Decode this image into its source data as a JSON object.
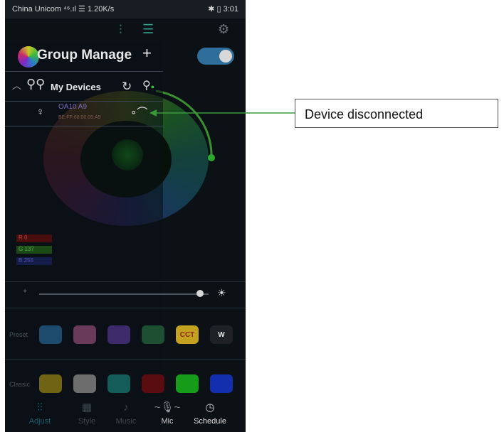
{
  "status_bar": {
    "left": "China Unicom ⁴⁶.ıl ☰ 1.20K/s",
    "right": "✱ ▯ 3:01"
  },
  "top_bar": {
    "icons": [
      "sliders-icon",
      "list-icon",
      "gear-icon"
    ]
  },
  "drawer": {
    "title": "Group Manage",
    "add_label": "+",
    "toggle_on": true,
    "group": {
      "label": "My Devices"
    },
    "device": {
      "name": "OA10 A9",
      "mac": "BE:FF:68:00:05:A9",
      "status_icon": "link-broken-icon"
    }
  },
  "rgb": {
    "r_label": "R",
    "r_value": "0",
    "g_label": "G",
    "g_value": "137",
    "b_label": "B",
    "b_value": "255"
  },
  "slider": {
    "level": 0.95
  },
  "preset": {
    "label": "Preset",
    "swatches": [
      {
        "color": "#1c4b6e",
        "text": ""
      },
      {
        "color": "#6a3a5a",
        "text": ""
      },
      {
        "color": "#3c2a6a",
        "text": ""
      },
      {
        "color": "#1d4f33",
        "text": ""
      },
      {
        "color": "#c4a11e",
        "text": "CCT"
      },
      {
        "color": "#1e2226",
        "text": "W"
      }
    ]
  },
  "classic": {
    "label": "Classic",
    "swatches": [
      {
        "color": "#6f6414"
      },
      {
        "color": "#6d6d6d"
      },
      {
        "color": "#135c5a"
      },
      {
        "color": "#5a0d10"
      },
      {
        "color": "#169c19"
      },
      {
        "color": "#142fae"
      }
    ]
  },
  "nav": {
    "items": [
      {
        "label": "Adjust",
        "icon": "sliders-icon",
        "active": true
      },
      {
        "label": "Style",
        "icon": "grid-icon",
        "active": false
      },
      {
        "label": "Music",
        "icon": "music-icon",
        "active": false
      },
      {
        "label": "Mic",
        "icon": "mic-icon",
        "active": false
      },
      {
        "label": "Schedule",
        "icon": "clock-icon",
        "active": false
      }
    ]
  },
  "callout": {
    "text": "Device disconnected"
  }
}
